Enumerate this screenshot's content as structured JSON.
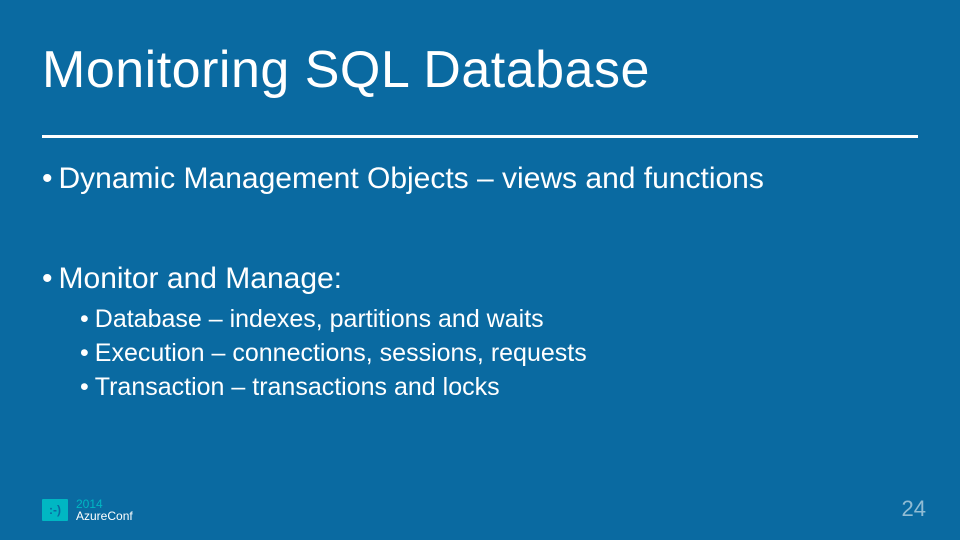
{
  "title": "Monitoring SQL Database",
  "bullets": {
    "item1": "Dynamic Management Objects – views and functions",
    "item2": "Monitor and Manage:",
    "sub1": "Database – indexes, partitions and waits",
    "sub2": "Execution – connections, sessions, requests",
    "sub3": "Transaction – transactions and locks"
  },
  "footer": {
    "badge": ":-)",
    "year": "2014",
    "conf": "AzureConf"
  },
  "page_number": "24"
}
